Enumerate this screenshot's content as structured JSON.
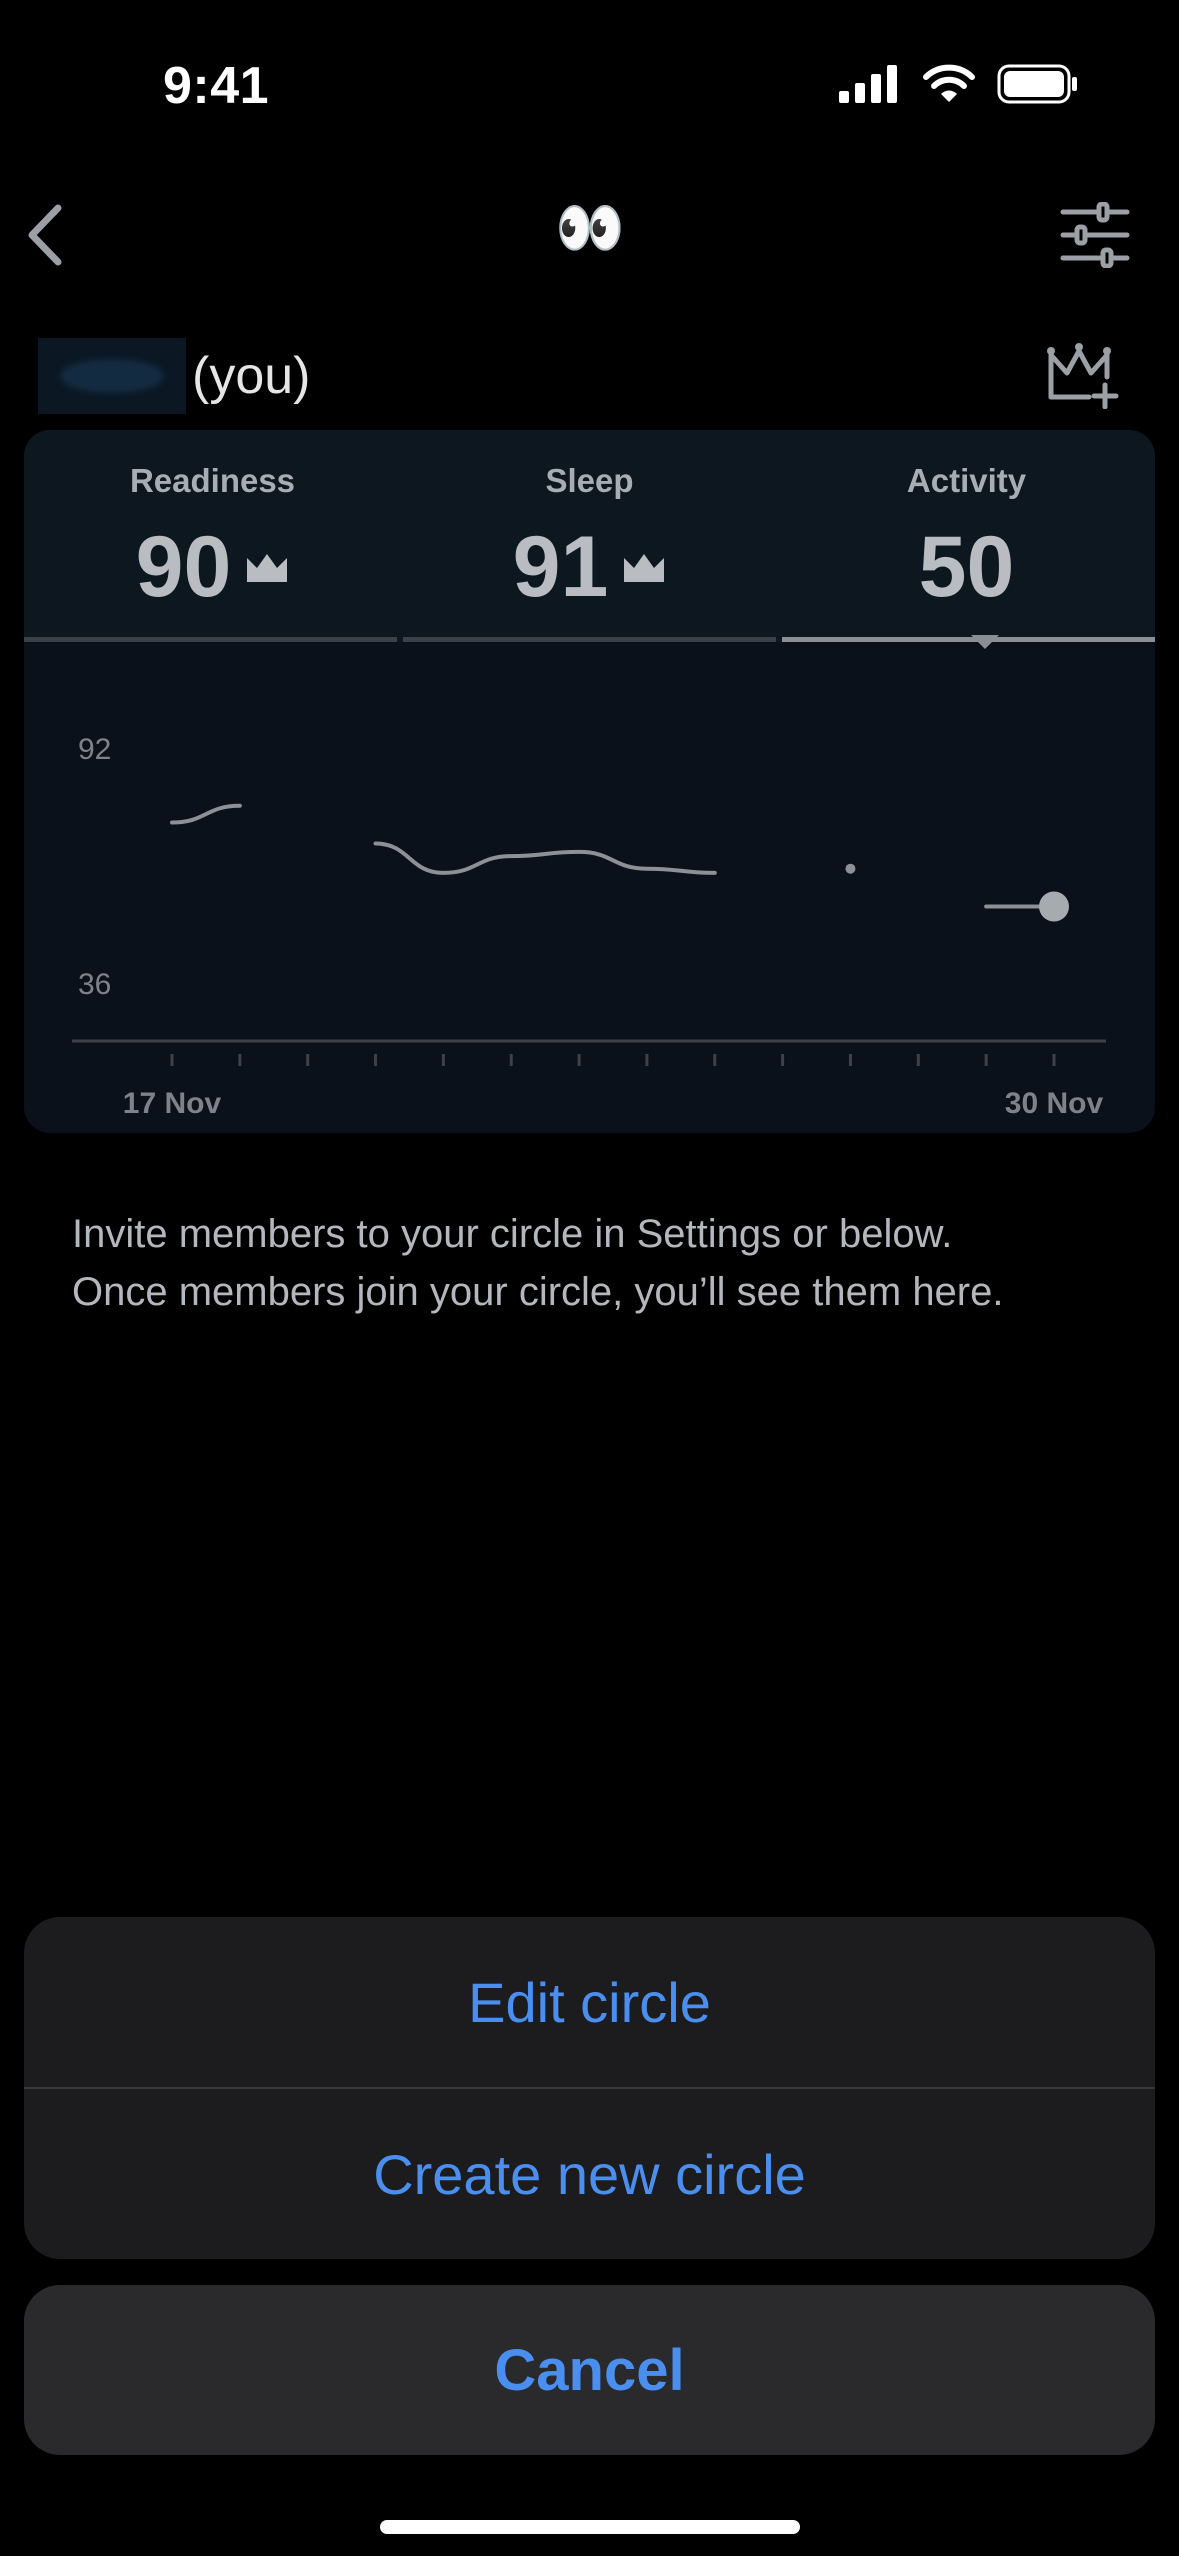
{
  "status_bar": {
    "time": "9:41"
  },
  "header": {
    "emoji": "👀"
  },
  "user": {
    "label": "(you)"
  },
  "metrics": [
    {
      "label": "Readiness",
      "value": "90",
      "crown": true
    },
    {
      "label": "Sleep",
      "value": "91",
      "crown": true
    },
    {
      "label": "Activity",
      "value": "50",
      "crown": false
    }
  ],
  "selected_metric": "Activity",
  "chart_data": {
    "type": "line",
    "title": "",
    "xlabel": "",
    "ylabel": "",
    "y_tick_labels": [
      "92",
      "36"
    ],
    "ylim": [
      36,
      92
    ],
    "x_tick_labels": [
      "17 Nov",
      "30 Nov"
    ],
    "x": [
      "17 Nov",
      "18 Nov",
      "19 Nov",
      "20 Nov",
      "21 Nov",
      "22 Nov",
      "23 Nov",
      "24 Nov",
      "25 Nov",
      "26 Nov",
      "27 Nov",
      "28 Nov",
      "29 Nov",
      "30 Nov"
    ],
    "series": [
      {
        "values": [
          74,
          78,
          null,
          69,
          62,
          66,
          67,
          63,
          62,
          null,
          63,
          null,
          54,
          54
        ]
      }
    ],
    "grid": false,
    "colors": {
      "line": "#8c9196",
      "axis": "#3c4248"
    }
  },
  "info_text": {
    "line1": "Invite members to your circle in Settings or below.",
    "line2": "Once members join your circle, you’ll see them here."
  },
  "action_sheet": {
    "edit": "Edit circle",
    "create": "Create new circle",
    "cancel": "Cancel"
  },
  "colors": {
    "accent": "#4a8ff0",
    "card": "#0b111a",
    "sheet": "#1c1c1e"
  }
}
